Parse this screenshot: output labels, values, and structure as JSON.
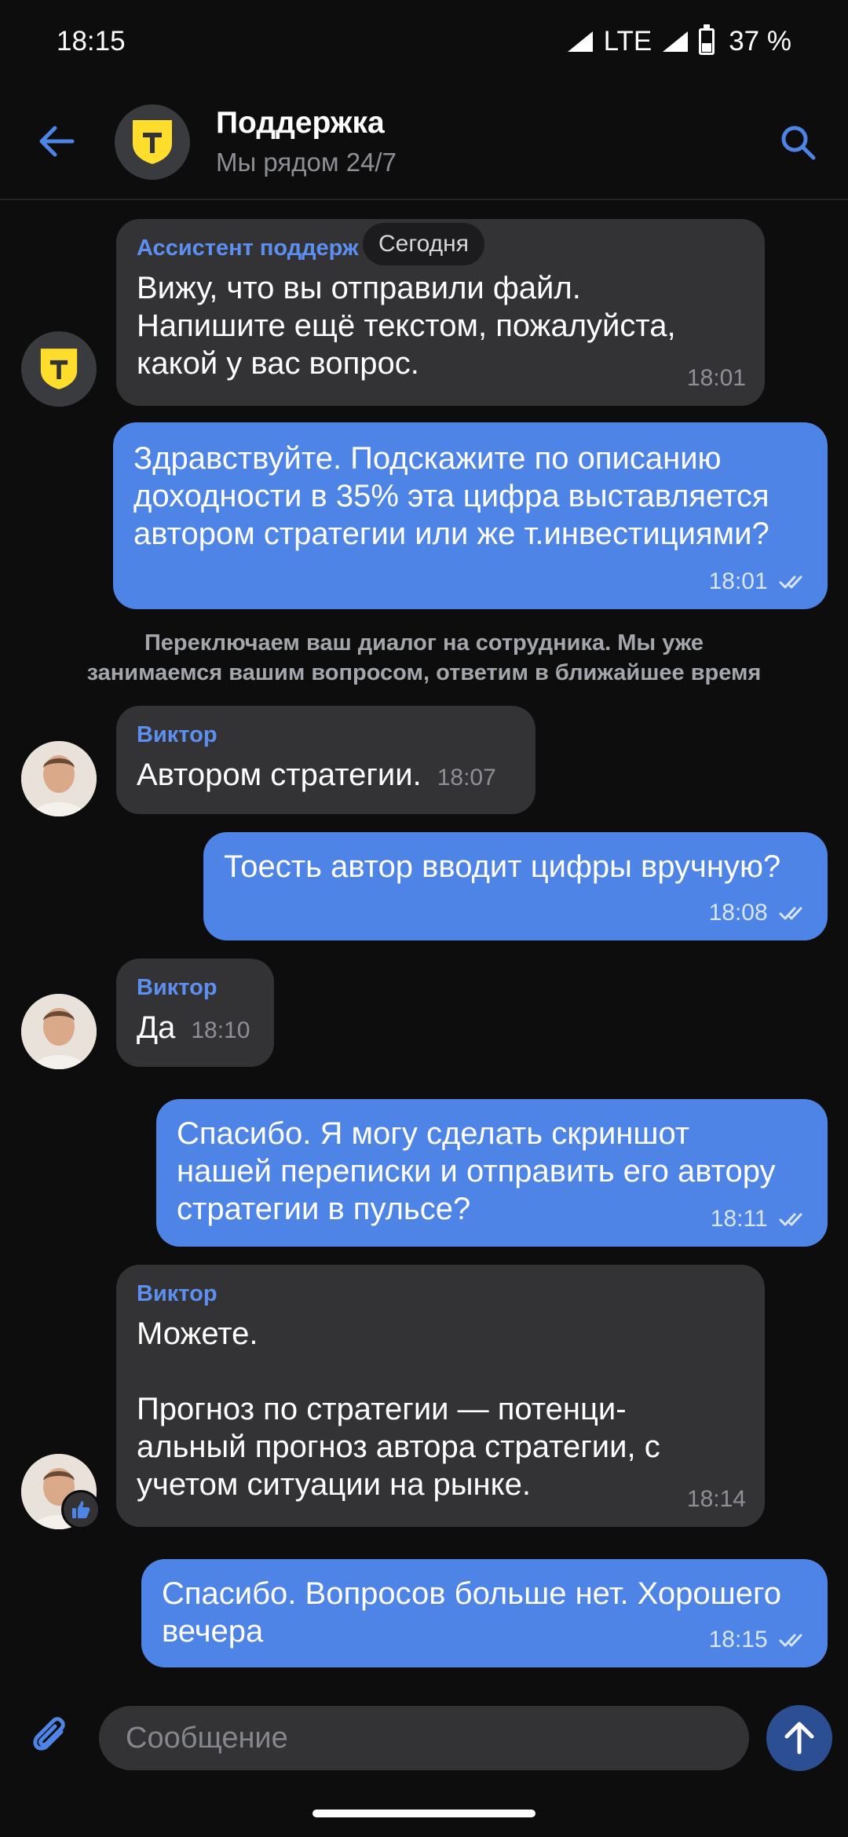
{
  "status_bar": {
    "time": "18:15",
    "network": "LTE",
    "battery": "37 %"
  },
  "header": {
    "title": "Поддержка",
    "subtitle": "Мы рядом 24/7"
  },
  "date_chip": "Сегодня",
  "messages": [
    {
      "sender": "Ассистент поддерж",
      "text": "Вижу, что вы отправили файл.\nНапишите ещё текстом, пожалуйста,\nкакой у вас вопрос.",
      "time": "18:01"
    },
    {
      "text": "Здравствуйте. Подскажите по описанию\nдоходности в 35% эта цифра выставляется\nавтором стратегии или же т.инвестициями?",
      "time": "18:01"
    },
    {
      "sender": "Виктор",
      "text": "Автором стратегии.",
      "time": "18:07"
    },
    {
      "text": "Тоесть автор вводит цифры вручную?",
      "time": "18:08"
    },
    {
      "sender": "Виктор",
      "text": "Да",
      "time": "18:10"
    },
    {
      "text": "Спасибо. Я могу сделать скриншот\nнашей переписки и отправить его автору\nстратегии в пульсе?",
      "time": "18:11"
    },
    {
      "sender": "Виктор",
      "text": "Можете.\n\nПрогноз по стратегии — потенци-\nальный прогноз автора стратегии, с\nучетом ситуации на рынке.",
      "time": "18:14"
    },
    {
      "text": "Спасибо. Вопросов больше нет. Хорошего\nвечера",
      "time": "18:15"
    }
  ],
  "system_note": "Переключаем ваш диалог на сотрудника. Мы уже\nзанимаемся вашим вопросом, ответим в ближайшее время",
  "composer": {
    "placeholder": "Сообщение"
  },
  "colors": {
    "accent": "#4e84e6",
    "incoming": "#333336",
    "sender": "#5d8ff0",
    "background": "#0d0d0e"
  }
}
